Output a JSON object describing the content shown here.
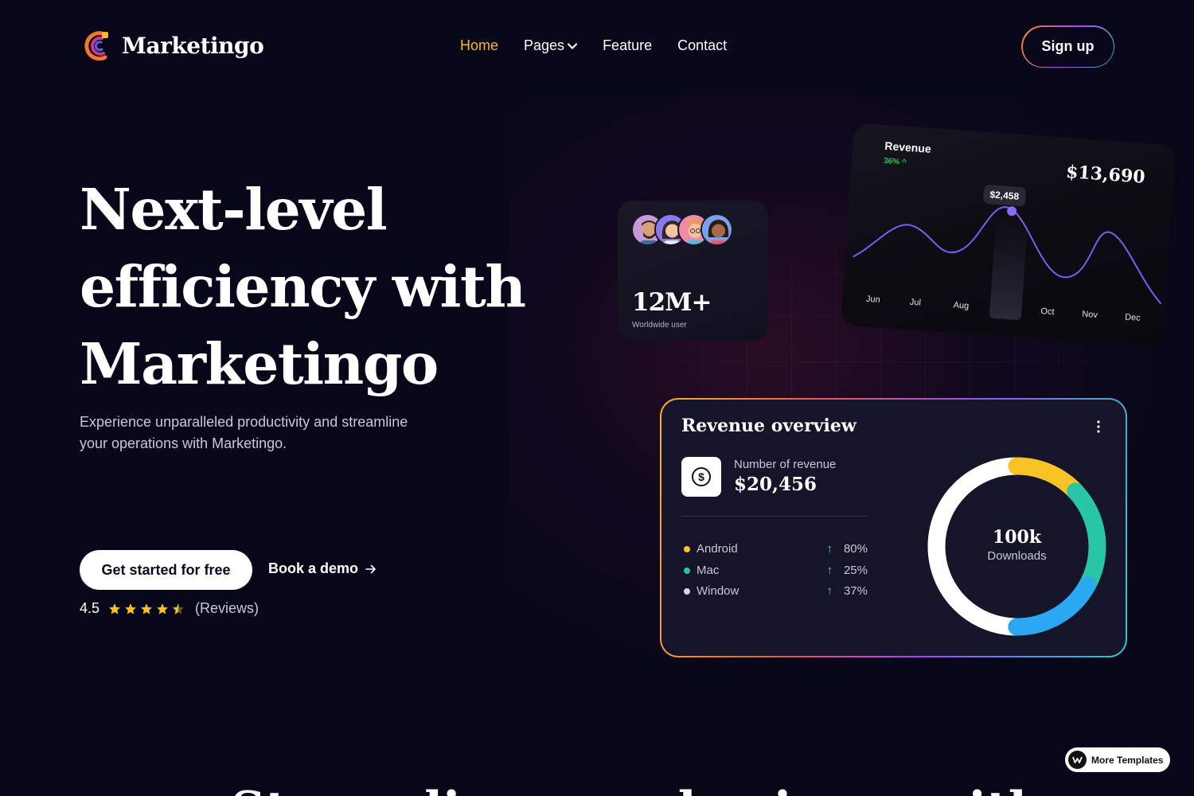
{
  "brand": {
    "name": "Marketingo"
  },
  "nav": {
    "items": [
      {
        "label": "Home",
        "active": true
      },
      {
        "label": "Pages",
        "dropdown": true
      },
      {
        "label": "Feature"
      },
      {
        "label": "Contact"
      }
    ],
    "signup_label": "Sign up"
  },
  "hero": {
    "title_lines": [
      "Next-level",
      "efficiency with",
      "Marketingo"
    ],
    "subtitle_lines": [
      "Experience unparalleled productivity and streamline",
      "your operations with Marketingo."
    ],
    "cta_primary": "Get started for free",
    "cta_secondary": "Book a demo",
    "rating_value": "4.5",
    "rating_stars": 4.5,
    "rating_label": "(Reviews)"
  },
  "users_card": {
    "count": "12M+",
    "label": "Worldwide user"
  },
  "revenue_card": {
    "title": "Revenue",
    "change": "36%",
    "amount": "$13,690",
    "tooltip": "$2,458",
    "months": [
      "Jun",
      "Jul",
      "Aug",
      "Oct",
      "Nov",
      "Dec"
    ]
  },
  "overview_card": {
    "title": "Revenue overview",
    "metric_label": "Number of revenue",
    "metric_value": "$20,456",
    "legend": [
      {
        "name": "Android",
        "value": "80%",
        "color": "#f7c325"
      },
      {
        "name": "Mac",
        "value": "25%",
        "color": "#26c6a6"
      },
      {
        "name": "Window",
        "value": "37%",
        "color": "#e8c8f8"
      }
    ],
    "donut_value": "100k",
    "donut_label": "Downloads",
    "donut_segments": [
      {
        "color": "#f7c325",
        "fraction": 0.13
      },
      {
        "color": "#26c6a6",
        "fraction": 0.2
      },
      {
        "color": "#2aa8f2",
        "fraction": 0.17
      },
      {
        "color": "#ffffff",
        "fraction": 0.5
      }
    ]
  },
  "badge": {
    "label": "More Templates"
  },
  "next_section": {
    "title_fragment": "Streamline your business with"
  },
  "colors": {
    "accent": "#f7b731",
    "background": "#08071a",
    "positive": "#22c55e",
    "chart_line": "#7b5cf0"
  }
}
